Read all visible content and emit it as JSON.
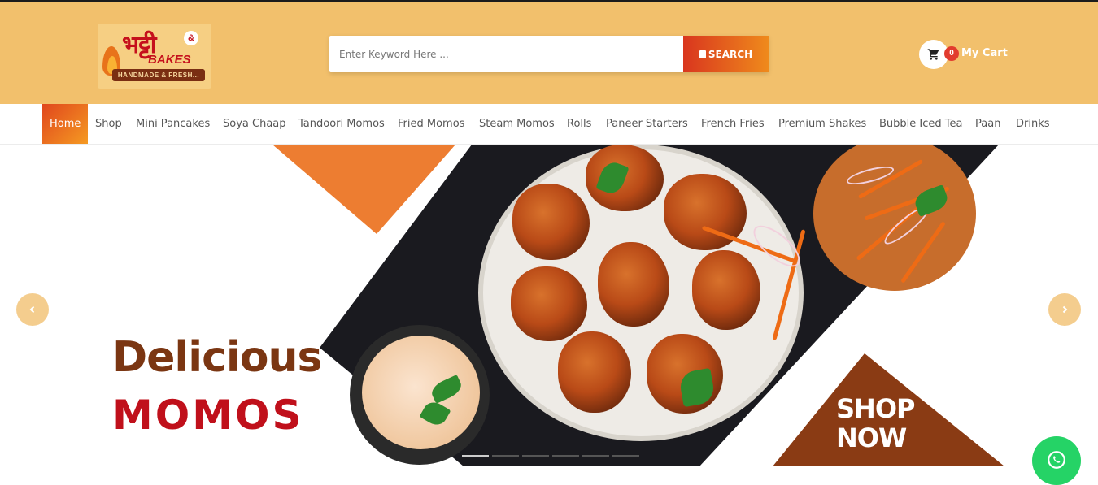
{
  "brand": {
    "logo_name": "भट्टी",
    "logo_amp": "&",
    "logo_sub": "BAKES",
    "logo_tagline": "HANDMADE & FRESH...",
    "logo_icon": "flame-icon"
  },
  "search": {
    "placeholder": "Enter Keyword Here ...",
    "value": "",
    "button_label": "SEARCH",
    "button_icon": "document-icon"
  },
  "cart": {
    "icon": "cart-icon",
    "count": "0",
    "label": "My Cart"
  },
  "nav": {
    "items": [
      {
        "label": "Home",
        "active": true
      },
      {
        "label": "Shop"
      },
      {
        "label": "Mini Pancakes"
      },
      {
        "label": "Soya Chaap"
      },
      {
        "label": "Tandoori Momos"
      },
      {
        "label": "Fried Momos"
      },
      {
        "label": "Steam Momos"
      },
      {
        "label": "Rolls"
      },
      {
        "label": "Paneer Starters"
      },
      {
        "label": "French Fries"
      },
      {
        "label": "Premium Shakes"
      },
      {
        "label": "Bubble Iced Tea"
      },
      {
        "label": "Paan"
      },
      {
        "label": "Drinks"
      }
    ]
  },
  "slider": {
    "headline_line1": "Delicious",
    "headline_line2": "MOMOS",
    "cta_line1": "SHOP",
    "cta_line2": "NOW",
    "prev_icon": "chevron-left-icon",
    "next_icon": "chevron-right-icon",
    "slide_count": 6,
    "active_slide": 1
  },
  "colors": {
    "header_bg": "#f2c06c",
    "accent_orange": "#ed7d31",
    "brand_brown": "#7b3612",
    "brand_red": "#c0101b",
    "whatsapp_green": "#25d366"
  },
  "floating": {
    "whatsapp_icon": "whatsapp-icon"
  }
}
